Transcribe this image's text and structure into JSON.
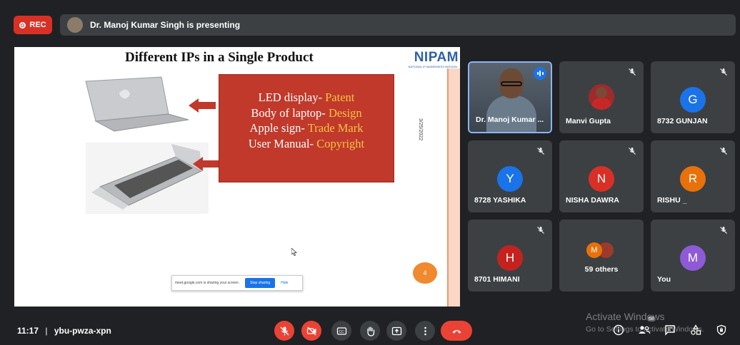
{
  "topbar": {
    "rec_label": "REC",
    "presenting_text": "Dr. Manoj Kumar Singh is presenting"
  },
  "slide": {
    "title": "Different IPs in a Single Product",
    "logo": "NIPAM",
    "logo_sub": "NATIONAL IP AWARENESS MISSION",
    "date": "3/25/2022",
    "lines": [
      {
        "label": "LED display- ",
        "value": "Patent"
      },
      {
        "label": "Body of laptop- ",
        "value": "Design"
      },
      {
        "label": "Apple sign- ",
        "value": "Trade Mark"
      },
      {
        "label": "User Manual- ",
        "value": "Copyright"
      }
    ],
    "page_number": "4",
    "share_notice": {
      "text": "meet.google.com is sharing your screen.",
      "stop_label": "Stop sharing",
      "hide_label": "Hide"
    }
  },
  "participants": [
    {
      "name": "Dr. Manoj Kumar ...",
      "type": "video"
    },
    {
      "name": "Manvi Gupta",
      "type": "photo"
    },
    {
      "name": "8732 GUNJAN",
      "initial": "G",
      "color": "#1a73e8"
    },
    {
      "name": "8728 YASHIKA",
      "initial": "Y",
      "color": "#1a73e8"
    },
    {
      "name": "NISHA DAWRA",
      "initial": "N",
      "color": "#d93025"
    },
    {
      "name": "RISHU _",
      "initial": "R",
      "color": "#e8710a"
    },
    {
      "name": "8701 HIMANI",
      "initial": "H",
      "color": "#c5221f"
    },
    {
      "name": "59 others",
      "initial": "M",
      "color": "#e8710a"
    },
    {
      "name": "You",
      "initial": "M",
      "color": "#8e5ad6"
    }
  ],
  "bottombar": {
    "time": "11:17",
    "separator": "|",
    "meeting_code": "ybu-pwza-xpn",
    "people_count": "68"
  },
  "watermark": {
    "line1": "Activate Windows",
    "line2": "Go to Settings to activate Windows."
  },
  "colors": {
    "background": "#202124",
    "tile": "#3c4043",
    "end_call": "#ea4335",
    "accent": "#1a73e8"
  }
}
